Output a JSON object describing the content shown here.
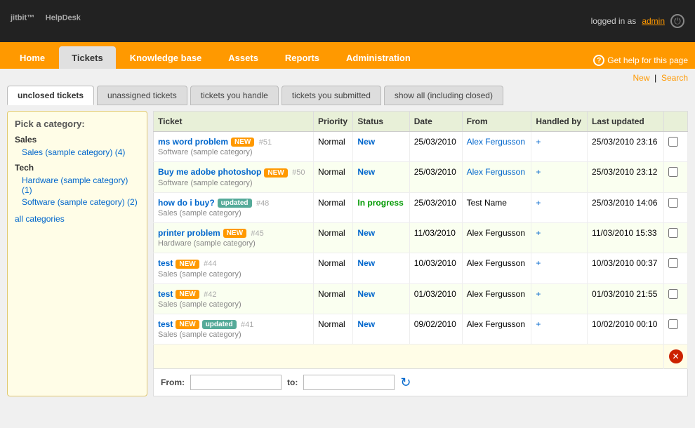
{
  "header": {
    "logo": "HelpDesk",
    "logo_prefix": "jitbit™",
    "user_label": "logged in as",
    "username": "admin",
    "help_label": "Get help for this page"
  },
  "nav": {
    "items": [
      {
        "label": "Home",
        "active": false
      },
      {
        "label": "Tickets",
        "active": true
      },
      {
        "label": "Knowledge base",
        "active": false
      },
      {
        "label": "Assets",
        "active": false
      },
      {
        "label": "Reports",
        "active": false
      },
      {
        "label": "Administration",
        "active": false
      }
    ]
  },
  "top_links": {
    "new": "New",
    "search": "Search"
  },
  "tabs": [
    {
      "label": "unclosed tickets",
      "active": true
    },
    {
      "label": "unassigned tickets",
      "active": false
    },
    {
      "label": "tickets you handle",
      "active": false
    },
    {
      "label": "tickets you submitted",
      "active": false
    },
    {
      "label": "show all (including closed)",
      "active": false
    }
  ],
  "sidebar": {
    "title": "Pick a category:",
    "groups": [
      {
        "name": "Sales",
        "items": [
          "Sales (sample category) (4)"
        ]
      },
      {
        "name": "Tech",
        "items": [
          "Hardware (sample category) (1)",
          "Software (sample category) (2)"
        ]
      }
    ],
    "all_link": "all categories"
  },
  "table": {
    "headers": [
      "Ticket",
      "Priority",
      "Status",
      "Date",
      "From",
      "Handled by",
      "Last updated",
      ""
    ],
    "rows": [
      {
        "id": "#51",
        "title": "ms word problem",
        "badges": [
          "new"
        ],
        "category": "Software (sample category)",
        "priority": "Normal",
        "status": "New",
        "date": "25/03/2010",
        "from": "Alex Fergusson",
        "from_link": true,
        "handled_by": "+",
        "last_updated": "25/03/2010 23:16"
      },
      {
        "id": "#50",
        "title": "Buy me adobe photoshop",
        "badges": [
          "new"
        ],
        "category": "Software (sample category)",
        "priority": "Normal",
        "status": "New",
        "date": "25/03/2010",
        "from": "Alex Fergusson",
        "from_link": true,
        "handled_by": "+",
        "last_updated": "25/03/2010 23:12"
      },
      {
        "id": "#48",
        "title": "how do i buy?",
        "badges": [
          "updated"
        ],
        "category": "Sales (sample category)",
        "priority": "Normal",
        "status": "In progress",
        "date": "25/03/2010",
        "from": "Test Name",
        "from_link": false,
        "handled_by": "+",
        "last_updated": "25/03/2010 14:06"
      },
      {
        "id": "#45",
        "title": "printer problem",
        "badges": [
          "new"
        ],
        "category": "Hardware (sample category)",
        "priority": "Normal",
        "status": "New",
        "date": "11/03/2010",
        "from": "Alex Fergusson",
        "from_link": false,
        "handled_by": "+",
        "last_updated": "11/03/2010 15:33"
      },
      {
        "id": "#44",
        "title": "test",
        "badges": [
          "new"
        ],
        "category": "Sales (sample category)",
        "priority": "Normal",
        "status": "New",
        "date": "10/03/2010",
        "from": "Alex Fergusson",
        "from_link": false,
        "handled_by": "+",
        "last_updated": "10/03/2010 00:37"
      },
      {
        "id": "#42",
        "title": "test",
        "badges": [
          "new"
        ],
        "category": "Sales (sample category)",
        "priority": "Normal",
        "status": "New",
        "date": "01/03/2010",
        "from": "Alex Fergusson",
        "from_link": false,
        "handled_by": "+",
        "last_updated": "01/03/2010 21:55"
      },
      {
        "id": "#41",
        "title": "test",
        "badges": [
          "new",
          "updated"
        ],
        "category": "Sales (sample category)",
        "priority": "Normal",
        "status": "New",
        "date": "09/02/2010",
        "from": "Alex Fergusson",
        "from_link": false,
        "handled_by": "+",
        "last_updated": "10/02/2010 00:10"
      }
    ]
  },
  "date_filter": {
    "from_label": "From:",
    "to_label": "to:",
    "from_value": "",
    "to_value": ""
  }
}
